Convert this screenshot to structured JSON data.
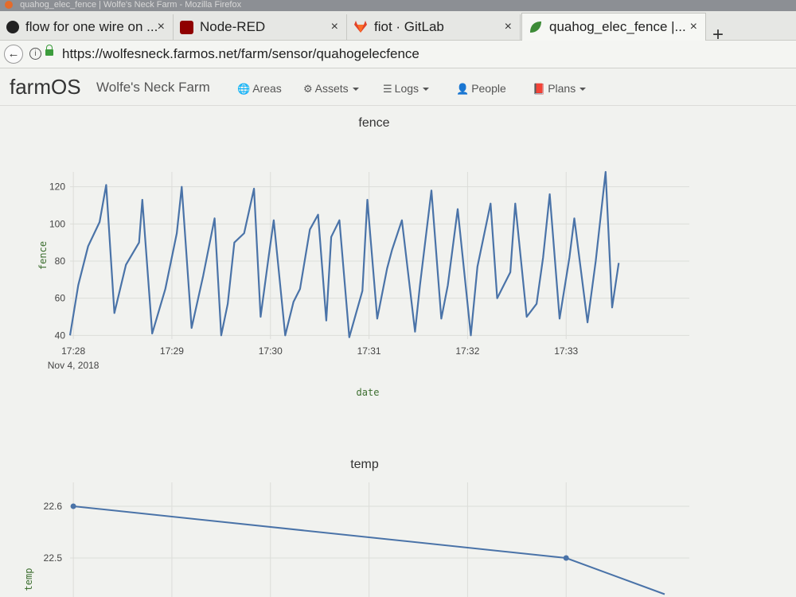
{
  "window": {
    "title": "quahog_elec_fence | Wolfe's Neck Farm - Mozilla Firefox"
  },
  "tabs": [
    {
      "label": "flow for one wire on ...",
      "icon": "github-icon",
      "active": false
    },
    {
      "label": "Node-RED",
      "icon": "node-red-icon",
      "active": false
    },
    {
      "label": "fiot · GitLab",
      "icon": "gitlab-icon",
      "active": false
    },
    {
      "label": "quahog_elec_fence |...",
      "icon": "farmos-leaf-icon",
      "active": true
    }
  ],
  "tab_close_glyph": "×",
  "new_tab_glyph": "+",
  "address_bar": {
    "url": "https://wolfesneck.farmos.net/farm/sensor/quahogelecfence"
  },
  "app": {
    "brand": "farmOS",
    "farm_name": "Wolfe's Neck Farm",
    "nav": [
      {
        "label": "Areas",
        "icon": "globe-icon",
        "dropdown": false
      },
      {
        "label": "Assets",
        "icon": "tractor-icon",
        "dropdown": true
      },
      {
        "label": "Logs",
        "icon": "list-icon",
        "dropdown": true
      },
      {
        "label": "People",
        "icon": "person-icon",
        "dropdown": false
      },
      {
        "label": "Plans",
        "icon": "book-icon",
        "dropdown": true
      }
    ]
  },
  "colors": {
    "series": "#4a73a8",
    "grid": "#dcddd9",
    "axis_title": "#3c6e2f"
  },
  "chart_data": [
    {
      "type": "line",
      "title": "fence",
      "xlabel": "date",
      "ylabel": "fence",
      "yticks": [
        40,
        60,
        80,
        100,
        120
      ],
      "ylim": [
        38,
        128
      ],
      "xlim": [
        "2018-11-04 17:27:58",
        "2018-11-04 17:34:15"
      ],
      "xticks": [
        {
          "label": "17:28",
          "sublabel": "Nov 4, 2018",
          "t": "2018-11-04 17:28:00"
        },
        {
          "label": "17:29",
          "t": "2018-11-04 17:29:00"
        },
        {
          "label": "17:30",
          "t": "2018-11-04 17:30:00"
        },
        {
          "label": "17:31",
          "t": "2018-11-04 17:31:00"
        },
        {
          "label": "17:32",
          "t": "2018-11-04 17:32:00"
        },
        {
          "label": "17:33",
          "t": "2018-11-04 17:33:00"
        }
      ],
      "grid": true,
      "series": [
        {
          "x": [
            "17:27:58",
            "17:28:03",
            "17:28:09",
            "17:28:16",
            "17:28:20",
            "17:28:25",
            "17:28:32",
            "17:28:40",
            "17:28:42",
            "17:28:48",
            "17:28:56",
            "17:29:03",
            "17:29:06",
            "17:29:12",
            "17:29:19",
            "17:29:26",
            "17:29:30",
            "17:29:34",
            "17:29:38",
            "17:29:44",
            "17:29:50",
            "17:29:54",
            "17:29:59",
            "17:30:02",
            "17:30:09",
            "17:30:14",
            "17:30:18",
            "17:30:24",
            "17:30:29",
            "17:30:34",
            "17:30:37",
            "17:30:42",
            "17:30:48",
            "17:30:56",
            "17:30:59",
            "17:31:05",
            "17:31:11",
            "17:31:14",
            "17:31:20",
            "17:31:28",
            "17:31:31",
            "17:31:38",
            "17:31:44",
            "17:31:48",
            "17:31:54",
            "17:32:02",
            "17:32:06",
            "17:32:14",
            "17:32:18",
            "17:32:26",
            "17:32:29",
            "17:32:36",
            "17:32:42",
            "17:32:46",
            "17:32:50",
            "17:32:56",
            "17:33:02",
            "17:33:05",
            "17:33:13",
            "17:33:18",
            "17:33:24",
            "17:33:28",
            "17:33:32"
          ],
          "y": [
            40,
            67,
            88,
            101,
            121,
            52,
            78,
            90,
            113,
            41,
            65,
            95,
            120,
            44,
            72,
            103,
            40,
            57,
            90,
            95,
            119,
            50,
            83,
            102,
            40,
            58,
            65,
            97,
            105,
            48,
            93,
            102,
            39,
            64,
            113,
            49,
            76,
            86,
            102,
            42,
            67,
            118,
            49,
            67,
            108,
            40,
            77,
            111,
            60,
            74,
            111,
            50,
            57,
            82,
            116,
            49,
            82,
            103,
            47,
            80,
            128,
            55,
            79
          ],
          "_note": ""
        }
      ]
    },
    {
      "type": "line",
      "title": "temp",
      "xlabel": "",
      "ylabel": "temp",
      "yticks": [
        22.5,
        22.6
      ],
      "grid": true,
      "series": [
        {
          "points": [
            {
              "t": "2018-11-04 17:28:00",
              "y": 22.6
            },
            {
              "t": "2018-11-04 17:33:00",
              "y": 22.5
            },
            {
              "t": "2018-11-04 17:34:00",
              "y": 22.43
            }
          ]
        }
      ]
    }
  ]
}
